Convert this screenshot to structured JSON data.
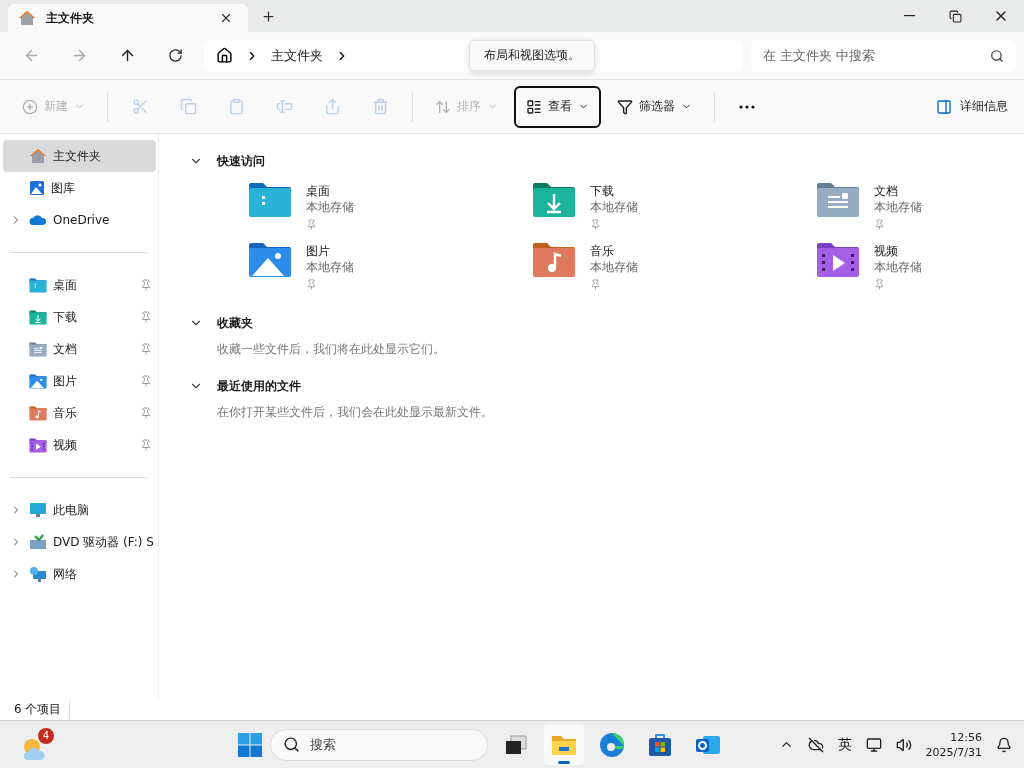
{
  "tab": {
    "title": "主文件夹"
  },
  "address": {
    "crumbs": [
      "主文件夹"
    ],
    "search_placeholder": "在 主文件夹 中搜索"
  },
  "tooltip": "布局和视图选项。",
  "toolbar": [
    {
      "kind": "menu",
      "label": "新建",
      "disabled": true,
      "focused": false
    },
    {
      "kind": "sep"
    },
    {
      "kind": "icon",
      "disabled": true
    },
    {
      "kind": "icon",
      "disabled": true
    },
    {
      "kind": "icon",
      "disabled": true
    },
    {
      "kind": "icon",
      "disabled": true
    },
    {
      "kind": "icon",
      "disabled": true
    },
    {
      "kind": "icon",
      "disabled": true
    },
    {
      "kind": "sep"
    },
    {
      "kind": "menu",
      "label": "排序",
      "disabled": true,
      "focused": false
    },
    {
      "kind": "menu",
      "label": "查看",
      "disabled": false,
      "focused": true
    },
    {
      "kind": "menu",
      "label": "筛选器",
      "disabled": false,
      "focused": false
    },
    {
      "kind": "sep"
    },
    {
      "kind": "icon",
      "disabled": false
    }
  ],
  "details_button": "详细信息",
  "sidebar": [
    [
      {
        "label": "主文件夹",
        "selected": true,
        "expandable": false,
        "pinned": false
      },
      {
        "label": "图库",
        "selected": false,
        "expandable": false,
        "pinned": false
      },
      {
        "label": "OneDrive",
        "selected": false,
        "expandable": true,
        "pinned": false
      }
    ],
    [
      {
        "label": "桌面",
        "selected": false,
        "expandable": false,
        "pinned": true
      },
      {
        "label": "下载",
        "selected": false,
        "expandable": false,
        "pinned": true
      },
      {
        "label": "文档",
        "selected": false,
        "expandable": false,
        "pinned": true
      },
      {
        "label": "图片",
        "selected": false,
        "expandable": false,
        "pinned": true
      },
      {
        "label": "音乐",
        "selected": false,
        "expandable": false,
        "pinned": true
      },
      {
        "label": "视频",
        "selected": false,
        "expandable": false,
        "pinned": true
      }
    ],
    [
      {
        "label": "此电脑",
        "selected": false,
        "expandable": true,
        "pinned": false
      },
      {
        "label": "DVD 驱动器 (F:) S",
        "selected": false,
        "expandable": true,
        "pinned": false
      },
      {
        "label": "网络",
        "selected": false,
        "expandable": true,
        "pinned": false
      }
    ]
  ],
  "sections": [
    {
      "title": "快速访问",
      "expanded": true,
      "folders": [
        {
          "name": "桌面",
          "location": "本地存储",
          "pinned": true
        },
        {
          "name": "下载",
          "location": "本地存储",
          "pinned": true
        },
        {
          "name": "文档",
          "location": "本地存储",
          "pinned": true
        },
        {
          "name": "图片",
          "location": "本地存储",
          "pinned": true
        },
        {
          "name": "音乐",
          "location": "本地存储",
          "pinned": true
        },
        {
          "name": "视频",
          "location": "本地存储",
          "pinned": true
        }
      ]
    },
    {
      "title": "收藏夹",
      "expanded": true,
      "empty_text": "收藏一些文件后，我们将在此处显示它们。"
    },
    {
      "title": "最近使用的文件",
      "expanded": true,
      "empty_text": "在你打开某些文件后，我们会在此处显示最新文件。"
    }
  ],
  "status_bar": "6 个项目",
  "taskbar": {
    "weather_badge": "4",
    "search": "搜索",
    "apps": [
      {
        "selected": false
      },
      {
        "selected": true
      },
      {
        "selected": false
      },
      {
        "selected": false
      },
      {
        "selected": false
      }
    ],
    "ime": "英",
    "time": "12:56",
    "date": "2025/7/31"
  }
}
